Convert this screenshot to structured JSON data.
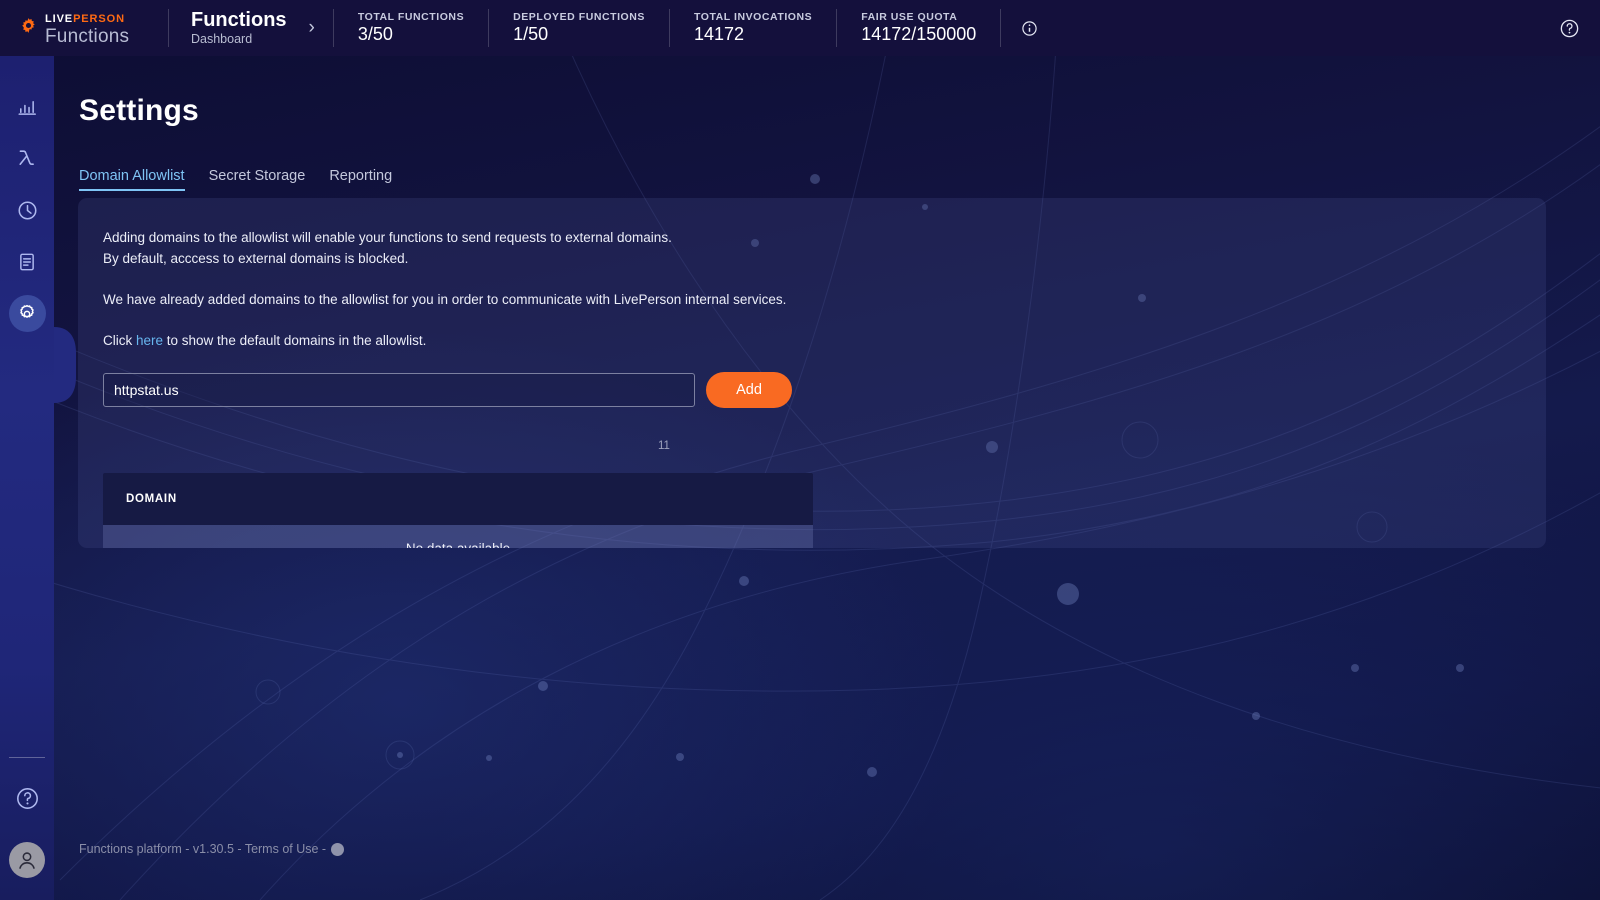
{
  "brand": {
    "live": "LIVE",
    "person": "PERSON",
    "product": "Functions",
    "gear_icon": "gear-icon"
  },
  "breadcrumb": {
    "title": "Functions",
    "subtitle": "Dashboard",
    "chevron": "›"
  },
  "stats": [
    {
      "label": "TOTAL FUNCTIONS",
      "value": "3/50"
    },
    {
      "label": "DEPLOYED FUNCTIONS",
      "value": "1/50"
    },
    {
      "label": "TOTAL INVOCATIONS",
      "value": "14172"
    },
    {
      "label": "FAIR USE QUOTA",
      "value": "14172/150000"
    }
  ],
  "topbar_icons": {
    "info": "info-circle-icon",
    "help": "help-circle-icon"
  },
  "sidebar": {
    "items": [
      {
        "name": "analytics",
        "icon": "bar-chart-icon",
        "active": false
      },
      {
        "name": "functions",
        "icon": "lambda-icon",
        "active": false
      },
      {
        "name": "history",
        "icon": "clock-icon",
        "active": false
      },
      {
        "name": "logs",
        "icon": "document-icon",
        "active": false
      },
      {
        "name": "settings",
        "icon": "gear-icon",
        "active": true
      }
    ],
    "help_icon": "help-circle-icon",
    "avatar_icon": "user-avatar-icon"
  },
  "page": {
    "title": "Settings"
  },
  "tabs": [
    {
      "label": "Domain Allowlist",
      "active": true
    },
    {
      "label": "Secret Storage",
      "active": false
    },
    {
      "label": "Reporting",
      "active": false
    }
  ],
  "allowlist": {
    "paragraph_1_line_1": "Adding domains to the allowlist will enable your functions to send requests to external domains.",
    "paragraph_1_line_2": "By default, acccess to external domains is blocked.",
    "paragraph_2": "We have already added domains to the allowlist for you in order to communicate with LivePerson internal services.",
    "click_prefix": "Click ",
    "click_link": "here",
    "click_suffix": " to show the default domains in the allowlist.",
    "input_value": "httpstat.us",
    "input_placeholder": "",
    "add_label": "Add",
    "counter": "11",
    "table": {
      "columns": [
        "DOMAIN"
      ],
      "rows": [],
      "empty_message": "No data available"
    }
  },
  "footer": {
    "text": "Functions platform - v1.30.5 - Terms of Use - ",
    "avatar_icon": "footer-avatar-icon"
  },
  "colors": {
    "accent_orange": "#f96a22",
    "brand_orange": "#ff6a13",
    "link_blue": "#67b6ef",
    "active_tab": "#7fc4f5",
    "topbar_bg": "#14103c",
    "sidebar_active": "#3a4a9e"
  }
}
